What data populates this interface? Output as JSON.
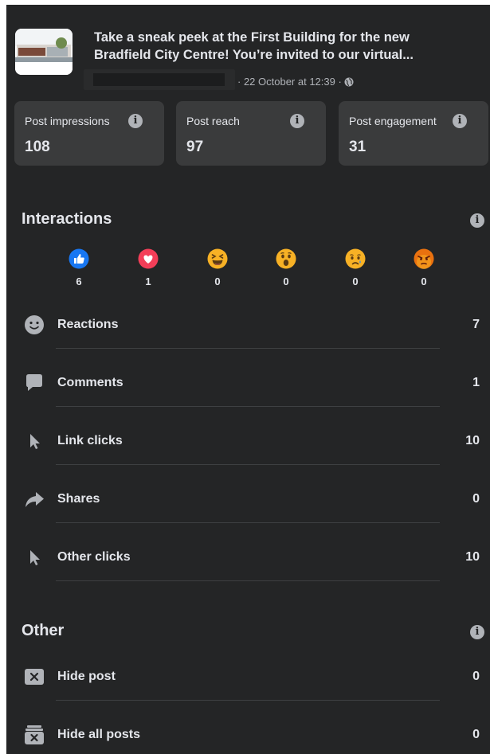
{
  "post": {
    "title_line1": "Take a sneak peek at the First Building for the new",
    "title_line2": "Bradfield City Centre! You’re invited to our virtual...",
    "meta": "· 22 October at 12:39 ·",
    "visibility_icon": "globe-icon"
  },
  "stats": [
    {
      "label": "Post impressions",
      "value": "108"
    },
    {
      "label": "Post reach",
      "value": "97"
    },
    {
      "label": "Post engagement",
      "value": "31"
    }
  ],
  "interactions": {
    "title": "Interactions",
    "reactions": [
      {
        "icon": "like-icon",
        "count": "6"
      },
      {
        "icon": "love-icon",
        "count": "1"
      },
      {
        "icon": "haha-icon",
        "count": "0"
      },
      {
        "icon": "wow-icon",
        "count": "0"
      },
      {
        "icon": "sad-icon",
        "count": "0"
      },
      {
        "icon": "angry-icon",
        "count": "0"
      }
    ],
    "rows": [
      {
        "icon": "smiley-icon",
        "label": "Reactions",
        "value": "7"
      },
      {
        "icon": "comment-icon",
        "label": "Comments",
        "value": "1"
      },
      {
        "icon": "cursor-icon",
        "label": "Link clicks",
        "value": "10"
      },
      {
        "icon": "share-icon",
        "label": "Shares",
        "value": "0"
      },
      {
        "icon": "cursor-icon",
        "label": "Other clicks",
        "value": "10"
      }
    ]
  },
  "other": {
    "title": "Other",
    "rows": [
      {
        "icon": "hide-post-icon",
        "label": "Hide post",
        "value": "0"
      },
      {
        "icon": "hide-all-icon",
        "label": "Hide all posts",
        "value": "0"
      }
    ]
  },
  "colors": {
    "panel_bg": "#242526",
    "card_bg": "#3a3b3c",
    "text": "#e4e6eb",
    "muted": "#b0b3b8",
    "like_blue": "#1877f2",
    "love_red": "#f33e58",
    "emoji_yellow": "#f7b125",
    "angry_orange": "#e9710f"
  }
}
